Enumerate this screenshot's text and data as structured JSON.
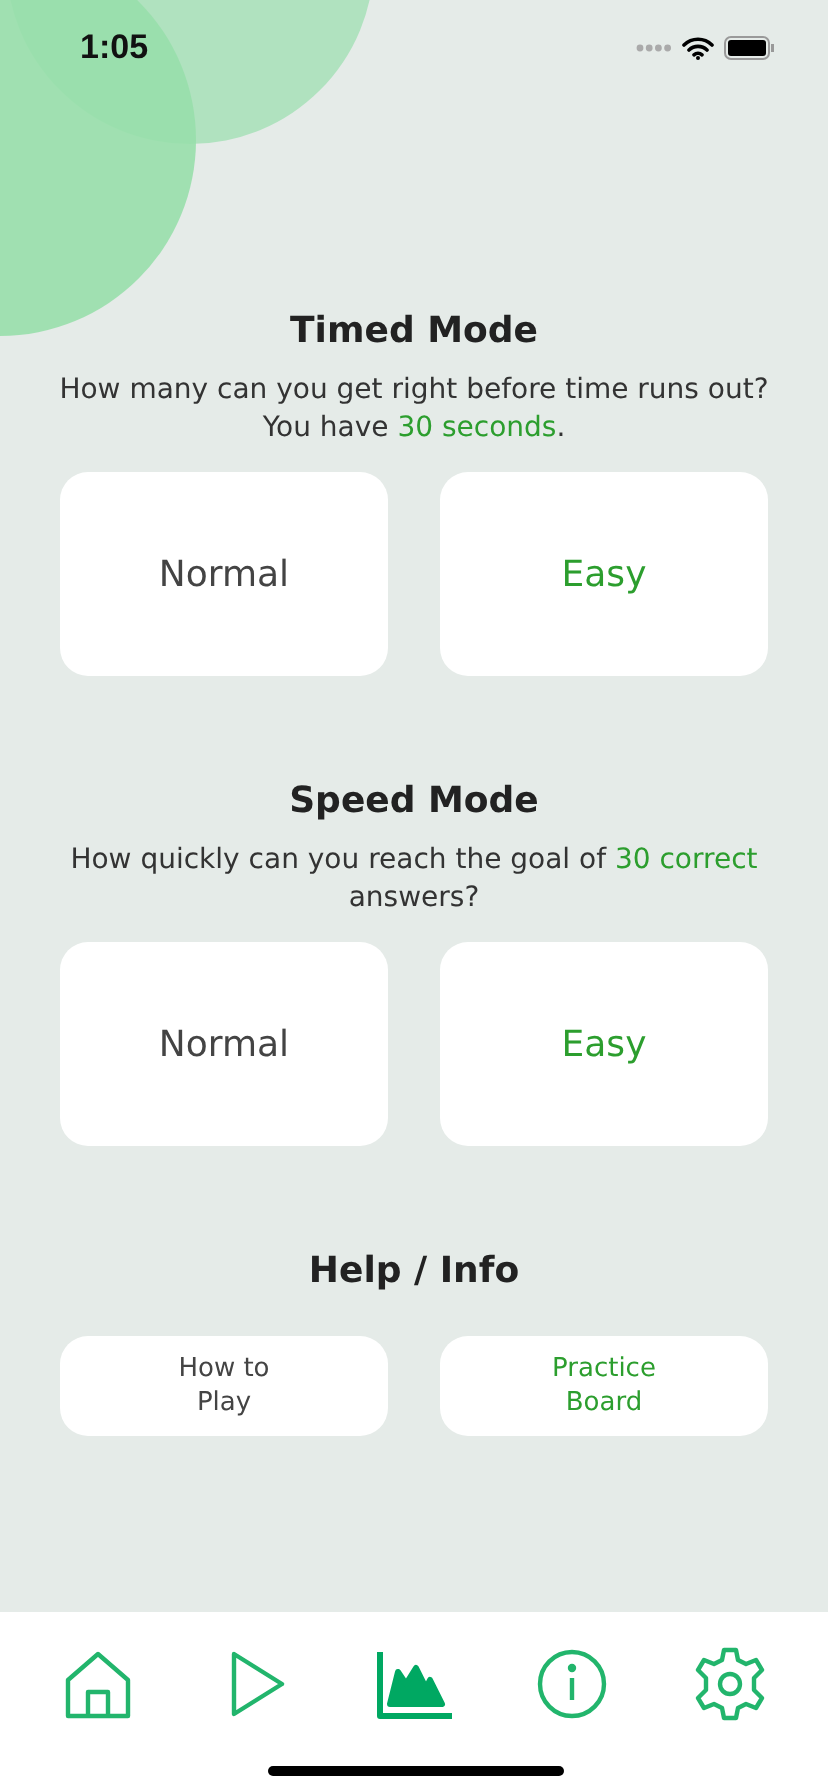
{
  "status_bar": {
    "time": "1:05"
  },
  "sections": [
    {
      "title": "Timed Mode",
      "description": [
        {
          "text": "How many can you get right before time runs out? You have ",
          "highlight": false
        },
        {
          "text": "30 seconds",
          "highlight": true
        },
        {
          "text": ".",
          "highlight": false
        }
      ],
      "buttons": [
        {
          "label": "Normal",
          "accent": false
        },
        {
          "label": "Easy",
          "accent": true
        }
      ]
    },
    {
      "title": "Speed Mode",
      "description": [
        {
          "text": "How quickly can you reach the goal of ",
          "highlight": false
        },
        {
          "text": "30 correct",
          "highlight": true
        },
        {
          "text": " answers?",
          "highlight": false
        }
      ],
      "buttons": [
        {
          "label": "Normal",
          "accent": false
        },
        {
          "label": "Easy",
          "accent": true
        }
      ]
    }
  ],
  "help": {
    "title": "Help / Info",
    "buttons": [
      {
        "label": "How to Play",
        "accent": false
      },
      {
        "label": "Practice Board",
        "accent": true
      }
    ]
  },
  "tab_bar": [
    {
      "kind": "home",
      "selected": false
    },
    {
      "kind": "play",
      "selected": false
    },
    {
      "kind": "stats",
      "selected": true
    },
    {
      "kind": "info",
      "selected": false
    },
    {
      "kind": "settings",
      "selected": false
    }
  ]
}
